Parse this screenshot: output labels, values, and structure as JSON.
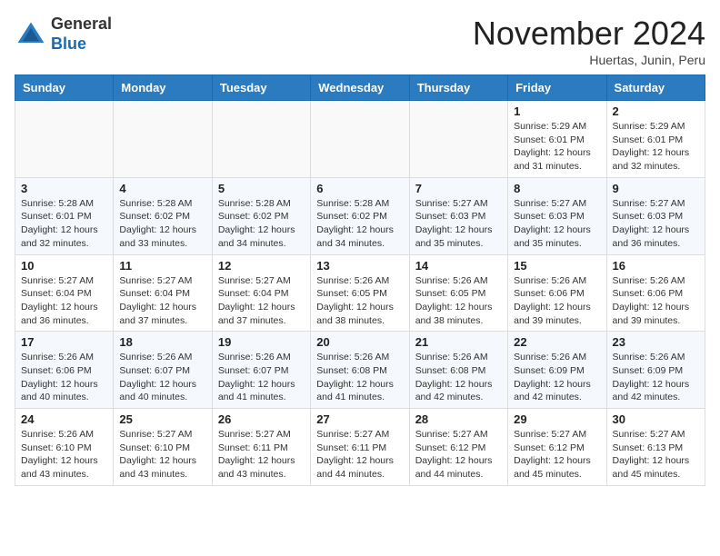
{
  "header": {
    "logo_line1": "General",
    "logo_line2": "Blue",
    "month_title": "November 2024",
    "location": "Huertas, Junin, Peru"
  },
  "days_of_week": [
    "Sunday",
    "Monday",
    "Tuesday",
    "Wednesday",
    "Thursday",
    "Friday",
    "Saturday"
  ],
  "weeks": [
    [
      {
        "day": "",
        "info": ""
      },
      {
        "day": "",
        "info": ""
      },
      {
        "day": "",
        "info": ""
      },
      {
        "day": "",
        "info": ""
      },
      {
        "day": "",
        "info": ""
      },
      {
        "day": "1",
        "info": "Sunrise: 5:29 AM\nSunset: 6:01 PM\nDaylight: 12 hours and 31 minutes."
      },
      {
        "day": "2",
        "info": "Sunrise: 5:29 AM\nSunset: 6:01 PM\nDaylight: 12 hours and 32 minutes."
      }
    ],
    [
      {
        "day": "3",
        "info": "Sunrise: 5:28 AM\nSunset: 6:01 PM\nDaylight: 12 hours and 32 minutes."
      },
      {
        "day": "4",
        "info": "Sunrise: 5:28 AM\nSunset: 6:02 PM\nDaylight: 12 hours and 33 minutes."
      },
      {
        "day": "5",
        "info": "Sunrise: 5:28 AM\nSunset: 6:02 PM\nDaylight: 12 hours and 34 minutes."
      },
      {
        "day": "6",
        "info": "Sunrise: 5:28 AM\nSunset: 6:02 PM\nDaylight: 12 hours and 34 minutes."
      },
      {
        "day": "7",
        "info": "Sunrise: 5:27 AM\nSunset: 6:03 PM\nDaylight: 12 hours and 35 minutes."
      },
      {
        "day": "8",
        "info": "Sunrise: 5:27 AM\nSunset: 6:03 PM\nDaylight: 12 hours and 35 minutes."
      },
      {
        "day": "9",
        "info": "Sunrise: 5:27 AM\nSunset: 6:03 PM\nDaylight: 12 hours and 36 minutes."
      }
    ],
    [
      {
        "day": "10",
        "info": "Sunrise: 5:27 AM\nSunset: 6:04 PM\nDaylight: 12 hours and 36 minutes."
      },
      {
        "day": "11",
        "info": "Sunrise: 5:27 AM\nSunset: 6:04 PM\nDaylight: 12 hours and 37 minutes."
      },
      {
        "day": "12",
        "info": "Sunrise: 5:27 AM\nSunset: 6:04 PM\nDaylight: 12 hours and 37 minutes."
      },
      {
        "day": "13",
        "info": "Sunrise: 5:26 AM\nSunset: 6:05 PM\nDaylight: 12 hours and 38 minutes."
      },
      {
        "day": "14",
        "info": "Sunrise: 5:26 AM\nSunset: 6:05 PM\nDaylight: 12 hours and 38 minutes."
      },
      {
        "day": "15",
        "info": "Sunrise: 5:26 AM\nSunset: 6:06 PM\nDaylight: 12 hours and 39 minutes."
      },
      {
        "day": "16",
        "info": "Sunrise: 5:26 AM\nSunset: 6:06 PM\nDaylight: 12 hours and 39 minutes."
      }
    ],
    [
      {
        "day": "17",
        "info": "Sunrise: 5:26 AM\nSunset: 6:06 PM\nDaylight: 12 hours and 40 minutes."
      },
      {
        "day": "18",
        "info": "Sunrise: 5:26 AM\nSunset: 6:07 PM\nDaylight: 12 hours and 40 minutes."
      },
      {
        "day": "19",
        "info": "Sunrise: 5:26 AM\nSunset: 6:07 PM\nDaylight: 12 hours and 41 minutes."
      },
      {
        "day": "20",
        "info": "Sunrise: 5:26 AM\nSunset: 6:08 PM\nDaylight: 12 hours and 41 minutes."
      },
      {
        "day": "21",
        "info": "Sunrise: 5:26 AM\nSunset: 6:08 PM\nDaylight: 12 hours and 42 minutes."
      },
      {
        "day": "22",
        "info": "Sunrise: 5:26 AM\nSunset: 6:09 PM\nDaylight: 12 hours and 42 minutes."
      },
      {
        "day": "23",
        "info": "Sunrise: 5:26 AM\nSunset: 6:09 PM\nDaylight: 12 hours and 42 minutes."
      }
    ],
    [
      {
        "day": "24",
        "info": "Sunrise: 5:26 AM\nSunset: 6:10 PM\nDaylight: 12 hours and 43 minutes."
      },
      {
        "day": "25",
        "info": "Sunrise: 5:27 AM\nSunset: 6:10 PM\nDaylight: 12 hours and 43 minutes."
      },
      {
        "day": "26",
        "info": "Sunrise: 5:27 AM\nSunset: 6:11 PM\nDaylight: 12 hours and 43 minutes."
      },
      {
        "day": "27",
        "info": "Sunrise: 5:27 AM\nSunset: 6:11 PM\nDaylight: 12 hours and 44 minutes."
      },
      {
        "day": "28",
        "info": "Sunrise: 5:27 AM\nSunset: 6:12 PM\nDaylight: 12 hours and 44 minutes."
      },
      {
        "day": "29",
        "info": "Sunrise: 5:27 AM\nSunset: 6:12 PM\nDaylight: 12 hours and 45 minutes."
      },
      {
        "day": "30",
        "info": "Sunrise: 5:27 AM\nSunset: 6:13 PM\nDaylight: 12 hours and 45 minutes."
      }
    ]
  ]
}
